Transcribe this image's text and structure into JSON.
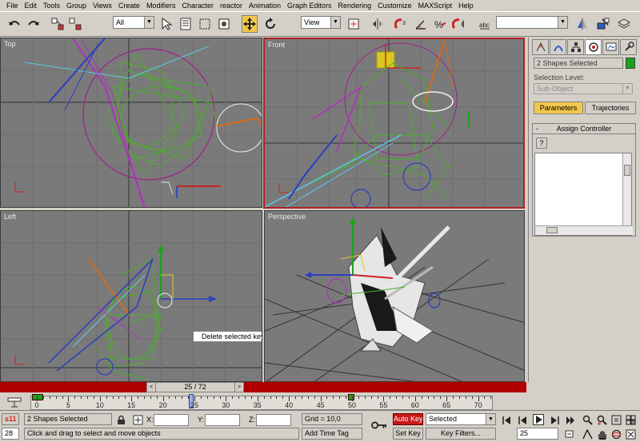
{
  "menu": [
    "File",
    "Edit",
    "Tools",
    "Group",
    "Views",
    "Create",
    "Modifiers",
    "Character",
    "reactor",
    "Animation",
    "Graph Editors",
    "Rendering",
    "Customize",
    "MAXScript",
    "Help"
  ],
  "toolbar": {
    "selection_filter": "All",
    "ref_coord": "View",
    "named_selection": "",
    "icons": [
      "undo-icon",
      "redo-icon",
      "select-link-icon",
      "unlink-icon",
      "select-icon",
      "select-by-name-icon",
      "rect-region-icon",
      "window-crossing-icon",
      "move-icon",
      "rotate-icon",
      "pivot-icon",
      "mirror-icon",
      "snap-3d-icon",
      "angle-snap-icon",
      "percent-snap-icon",
      "spinner-snap-icon",
      "edit-named-icon",
      "mirror-tool-icon",
      "align-icon"
    ]
  },
  "viewports": {
    "top": "Top",
    "front": "Front",
    "left": "Left",
    "perspective": "Perspective",
    "tooltip": "Delete selected key"
  },
  "command_panel": {
    "selection_name": "2 Shapes Selected",
    "selection_level_label": "Selection Level:",
    "sub_object": "Sub-Object",
    "parameters_tab": "Parameters",
    "trajectories_tab": "Trajectories",
    "rollout_title": "Assign Controller",
    "collapse_glyph": "-",
    "help_glyph": "?"
  },
  "time": {
    "slider_text": "25 / 72",
    "ruler_labels": [
      "0",
      "5",
      "10",
      "15",
      "20",
      "25",
      "30",
      "35",
      "40",
      "45",
      "50",
      "55",
      "60",
      "65",
      "70"
    ]
  },
  "status": {
    "mode_badge": "s11",
    "frame_small": "28",
    "selected_text": "2 Shapes Selected",
    "prompt": "Click and drag to select and move objects",
    "x_label": "X:",
    "y_label": "Y:",
    "z_label": "Z:",
    "x_value": "",
    "y_value": "",
    "z_value": "",
    "grid": "Grid = 10,0",
    "add_time_tag": "Add Time Tag",
    "auto_key": "Auto Key",
    "set_key": "Set Key",
    "key_mode_select": "Selected",
    "key_filters": "Key Filters...",
    "current_frame": "25"
  },
  "colors": {
    "ui_gray": "#d4d0c8",
    "viewport_bg": "#7a7a7a",
    "active_border": "#b02020",
    "time_bar": "#b00000",
    "wire_green": "#4caf2a",
    "wire_magenta": "#b030c0",
    "wire_blue": "#2a3ec0",
    "wire_cyan": "#5ec8e8",
    "auto_key_red": "#c81818",
    "selection_swatch": "#1aa31a"
  }
}
